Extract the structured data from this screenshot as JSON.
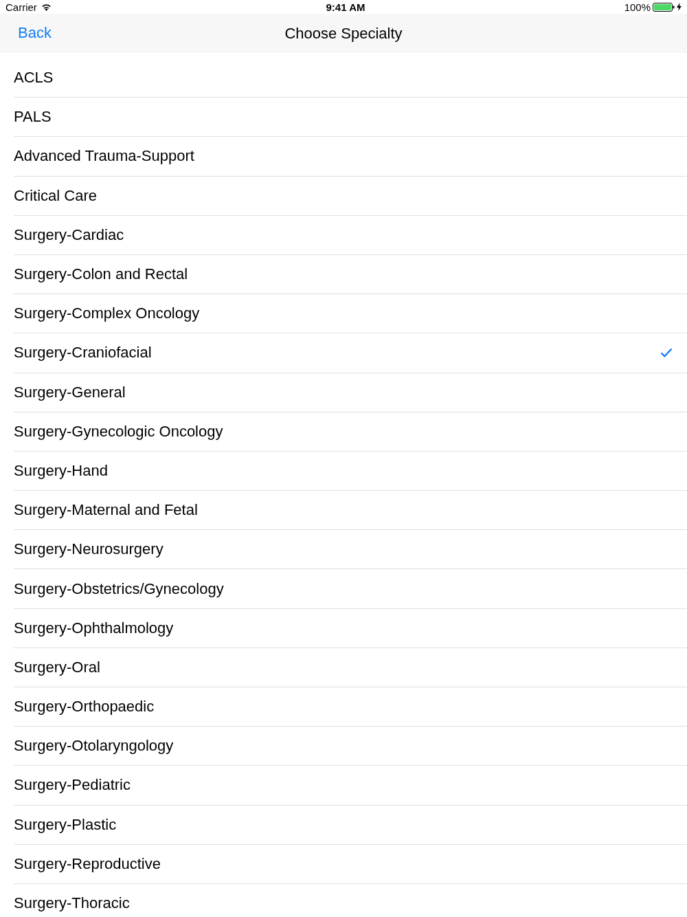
{
  "status_bar": {
    "carrier": "Carrier",
    "time": "9:41 AM",
    "battery": "100%"
  },
  "nav_bar": {
    "back": "Back",
    "title": "Choose Specialty"
  },
  "items": [
    {
      "label": "ACLS",
      "selected": false
    },
    {
      "label": "PALS",
      "selected": false
    },
    {
      "label": "Advanced Trauma-Support",
      "selected": false
    },
    {
      "label": "Critical Care",
      "selected": false
    },
    {
      "label": "Surgery-Cardiac",
      "selected": false
    },
    {
      "label": "Surgery-Colon and Rectal",
      "selected": false
    },
    {
      "label": "Surgery-Complex Oncology",
      "selected": false
    },
    {
      "label": "Surgery-Craniofacial",
      "selected": true
    },
    {
      "label": "Surgery-General",
      "selected": false
    },
    {
      "label": "Surgery-Gynecologic Oncology",
      "selected": false
    },
    {
      "label": "Surgery-Hand",
      "selected": false
    },
    {
      "label": "Surgery-Maternal and Fetal",
      "selected": false
    },
    {
      "label": "Surgery-Neurosurgery",
      "selected": false
    },
    {
      "label": "Surgery-Obstetrics/Gynecology",
      "selected": false
    },
    {
      "label": "Surgery-Ophthalmology",
      "selected": false
    },
    {
      "label": "Surgery-Oral",
      "selected": false
    },
    {
      "label": "Surgery-Orthopaedic",
      "selected": false
    },
    {
      "label": "Surgery-Otolaryngology",
      "selected": false
    },
    {
      "label": "Surgery-Pediatric",
      "selected": false
    },
    {
      "label": "Surgery-Plastic",
      "selected": false
    },
    {
      "label": "Surgery-Reproductive",
      "selected": false
    },
    {
      "label": "Surgery-Thoracic",
      "selected": false
    }
  ]
}
